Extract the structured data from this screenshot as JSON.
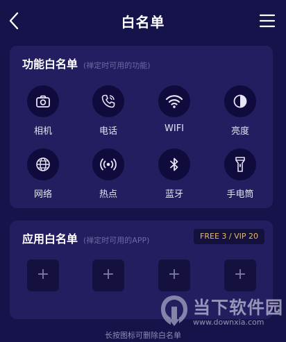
{
  "header": {
    "title": "白名单"
  },
  "function_card": {
    "title": "功能白名单",
    "subtitle": "(禅定时可用的功能)",
    "items": [
      {
        "label": "相机",
        "icon": "camera-icon"
      },
      {
        "label": "电话",
        "icon": "phone-icon"
      },
      {
        "label": "WIFI",
        "icon": "wifi-icon"
      },
      {
        "label": "亮度",
        "icon": "brightness-icon"
      },
      {
        "label": "网络",
        "icon": "globe-icon"
      },
      {
        "label": "热点",
        "icon": "hotspot-icon"
      },
      {
        "label": "蓝牙",
        "icon": "bluetooth-icon"
      },
      {
        "label": "手电筒",
        "icon": "flashlight-icon"
      }
    ]
  },
  "app_card": {
    "title": "应用白名单",
    "subtitle": "(禅定时可用的APP)",
    "badge": "FREE 3 / VIP 20",
    "add_label": "+"
  },
  "hint": "长按图标可删除白名单",
  "watermark": {
    "text": "当下软件园",
    "url": "www.downxia.com"
  },
  "colors": {
    "background": "#16124a",
    "card": "#221e5f",
    "icon_bg": "#0f0b3c",
    "badge_text": "#e8b86e"
  }
}
